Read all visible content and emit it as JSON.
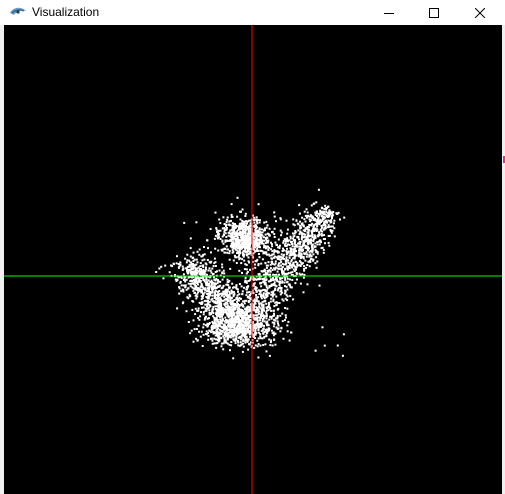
{
  "window": {
    "title": "Visualization",
    "icon": "app-eye-icon",
    "controls": {
      "minimize": "minimize-icon",
      "maximize": "maximize-icon",
      "close": "close-icon"
    }
  },
  "canvas": {
    "background": "#000000",
    "point_color": "#ffffff",
    "vertical_axis_color": "#ff0000",
    "horizontal_axis_color": "#00ff00"
  }
}
